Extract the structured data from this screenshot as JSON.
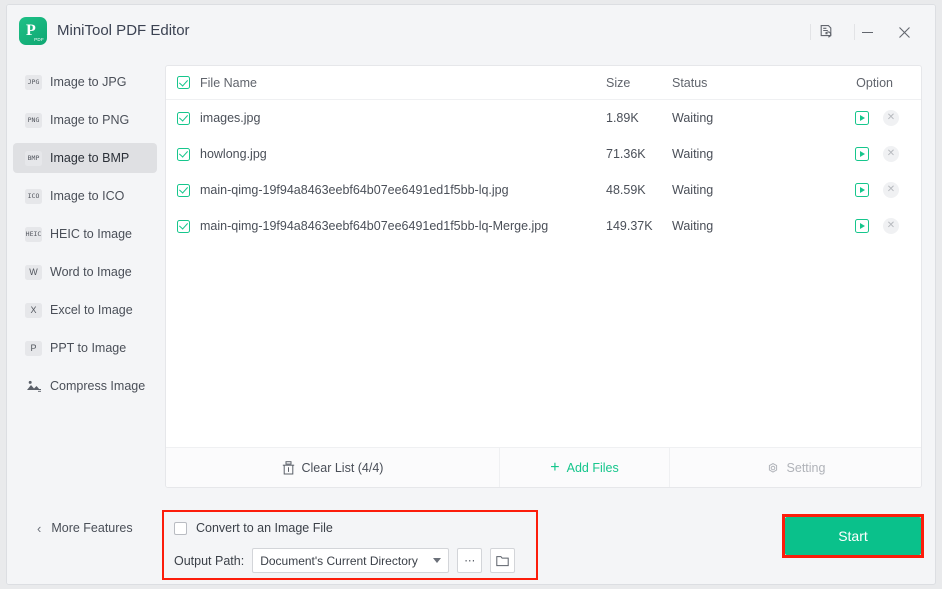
{
  "window": {
    "title": "MiniTool PDF Editor",
    "logo_mark": "P",
    "logo_sub": "PDF",
    "convert_icon": "document-convert-icon",
    "minimize_label": "—",
    "close_label": "✕"
  },
  "sidebar": {
    "items": [
      {
        "icon": "JPG",
        "icon_name": "jpg-format-icon",
        "label": "Image to JPG",
        "active": false
      },
      {
        "icon": "PNG",
        "icon_name": "png-format-icon",
        "label": "Image to PNG",
        "active": false
      },
      {
        "icon": "BMP",
        "icon_name": "bmp-format-icon",
        "label": "Image to BMP",
        "active": true
      },
      {
        "icon": "ICO",
        "icon_name": "ico-format-icon",
        "label": "Image to ICO",
        "active": false
      },
      {
        "icon": "HEIC",
        "icon_name": "heic-format-icon",
        "label": "HEIC to Image",
        "active": false
      },
      {
        "icon": "W",
        "icon_name": "word-format-icon",
        "label": "Word to Image",
        "active": false
      },
      {
        "icon": "X",
        "icon_name": "excel-format-icon",
        "label": "Excel to Image",
        "active": false
      },
      {
        "icon": "P",
        "icon_name": "ppt-format-icon",
        "label": "PPT to Image",
        "active": false
      },
      {
        "icon": "⚙",
        "icon_name": "compress-image-icon",
        "label": "Compress Image",
        "active": false
      }
    ],
    "more_features": {
      "label": "More Features",
      "chevron": "‹"
    }
  },
  "file_list": {
    "headers": {
      "file_name": "File Name",
      "size": "Size",
      "status": "Status",
      "option": "Option"
    },
    "select_all_checked": true,
    "rows": [
      {
        "checked": true,
        "name": "images.jpg",
        "size": "1.89K",
        "status": "Waiting"
      },
      {
        "checked": true,
        "name": "howlong.jpg",
        "size": "71.36K",
        "status": "Waiting"
      },
      {
        "checked": true,
        "name": "main-qimg-19f94a8463eebf64b07ee6491ed1f5bb-lq.jpg",
        "size": "48.59K",
        "status": "Waiting"
      },
      {
        "checked": true,
        "name": "main-qimg-19f94a8463eebf64b07ee6491ed1f5bb-lq-Merge.jpg",
        "size": "149.37K",
        "status": "Waiting"
      }
    ],
    "footer": {
      "clear_list": "Clear List (4/4)",
      "add_files": "Add Files",
      "add_files_plus": "+",
      "setting": "Setting"
    }
  },
  "output": {
    "convert_checkbox_label": "Convert to an Image File",
    "convert_checked": false,
    "path_label": "Output Path:",
    "path_value": "Document's Current Directory",
    "browse_dots": "⋯",
    "folder_icon": "folder-open-icon"
  },
  "actions": {
    "start_label": "Start"
  },
  "colors": {
    "accent_green": "#0ac18b",
    "highlight_red": "#fc1d0b",
    "window_bg": "#f4f5f7",
    "panel_bg": "#ffffff"
  }
}
